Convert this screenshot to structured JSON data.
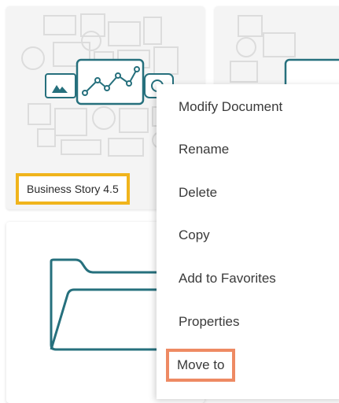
{
  "cards": [
    {
      "title": "Business Story 4.5",
      "thumbnail_icon": "line-chart-icon",
      "highlight_color": "#f0b41c"
    },
    {
      "thumbnail_icon": "line-chart-icon"
    },
    {
      "thumbnail_icon": "folder-icon"
    }
  ],
  "context_menu": {
    "items": [
      {
        "label": "Modify Document"
      },
      {
        "label": "Rename"
      },
      {
        "label": "Delete"
      },
      {
        "label": "Copy"
      },
      {
        "label": "Add to Favorites"
      },
      {
        "label": "Properties"
      },
      {
        "label": "Move to"
      }
    ],
    "highlighted_item": "Move to",
    "highlight_color": "#ee8a63"
  },
  "colors": {
    "accent": "#26707d",
    "card_background": "#f4f4f4"
  }
}
